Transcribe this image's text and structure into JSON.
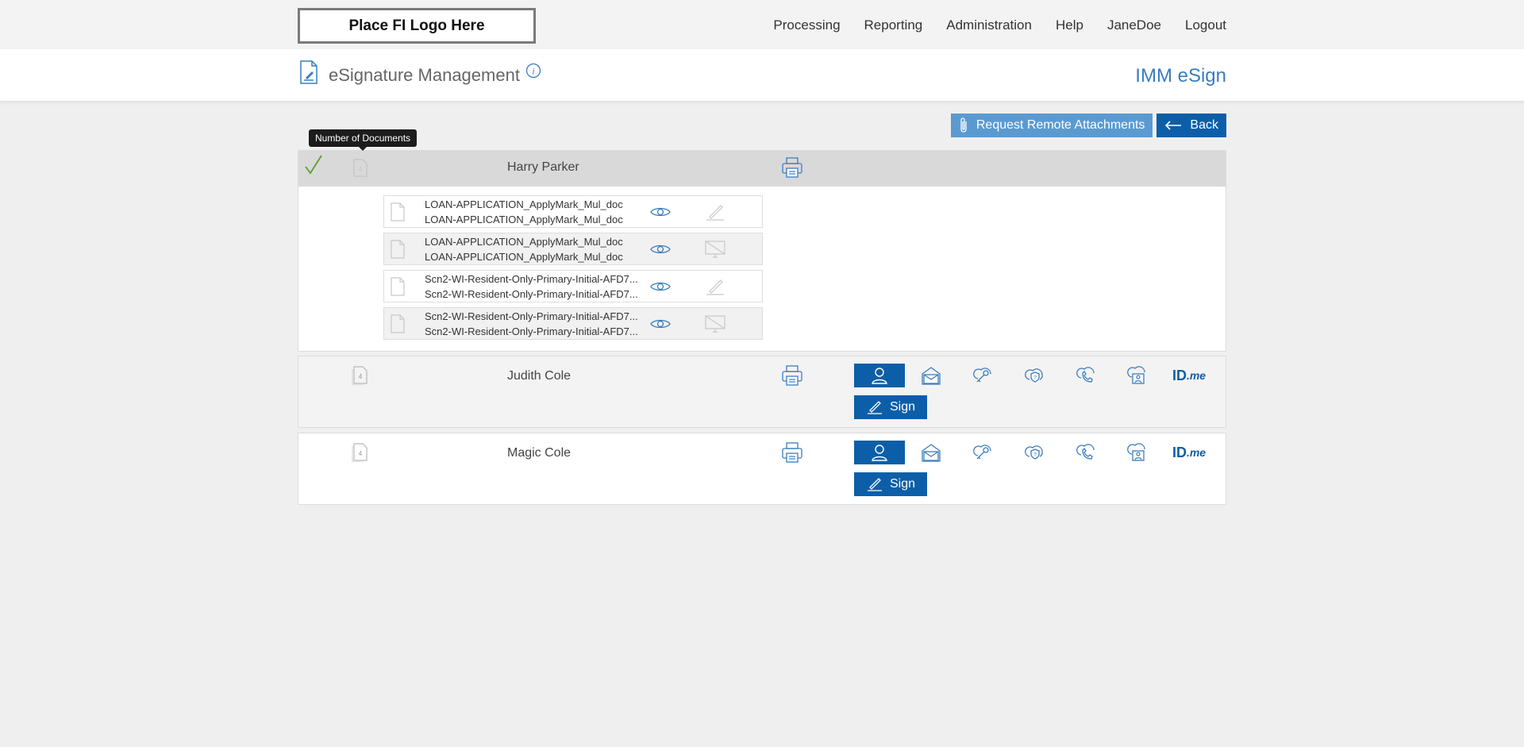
{
  "header": {
    "logo_text": "Place FI Logo Here",
    "nav": [
      "Processing",
      "Reporting",
      "Administration",
      "Help",
      "JaneDoe",
      "Logout"
    ]
  },
  "titlebar": {
    "title": "eSignature Management",
    "app_name": "IMM eSign"
  },
  "actions": {
    "request_attachments": "Request Remote Attachments",
    "back": "Back"
  },
  "tooltip": "Number of Documents",
  "signers": [
    {
      "name": "Harry Parker",
      "doc_count": "4",
      "completed": true,
      "documents": [
        {
          "line1": "LOAN-APPLICATION_ApplyMark_Mul_doc",
          "line2": "LOAN-APPLICATION_ApplyMark_Mul_doc",
          "action_icon": "pen-icon"
        },
        {
          "line1": "LOAN-APPLICATION_ApplyMark_Mul_doc",
          "line2": "LOAN-APPLICATION_ApplyMark_Mul_doc",
          "action_icon": "monitor-disabled-icon"
        },
        {
          "line1": "Scn2-WI-Resident-Only-Primary-Initial-AFD7...",
          "line2": "Scn2-WI-Resident-Only-Primary-Initial-AFD7...",
          "action_icon": "pen-icon"
        },
        {
          "line1": "Scn2-WI-Resident-Only-Primary-Initial-AFD7...",
          "line2": "Scn2-WI-Resident-Only-Primary-Initial-AFD7...",
          "action_icon": "monitor-disabled-icon"
        }
      ]
    },
    {
      "name": "Judith Cole",
      "doc_count": "4",
      "sign_label": "Sign",
      "methods": [
        "in-person-icon",
        "email-icon",
        "cloud-key-icon",
        "cloud-question-icon",
        "cloud-phone-icon",
        "cloud-person-icon",
        "ID.me"
      ]
    },
    {
      "name": "Magic Cole",
      "doc_count": "4",
      "sign_label": "Sign",
      "methods": [
        "in-person-icon",
        "email-icon",
        "cloud-key-icon",
        "cloud-question-icon",
        "cloud-phone-icon",
        "cloud-person-icon",
        "ID.me"
      ]
    }
  ],
  "idme": {
    "brand": "ID",
    "suffix": ".me"
  },
  "colors": {
    "accent": "#0d5ea8",
    "accent_light": "#5b9ad1",
    "link": "#3a7dbf",
    "check": "#5aa02c"
  }
}
